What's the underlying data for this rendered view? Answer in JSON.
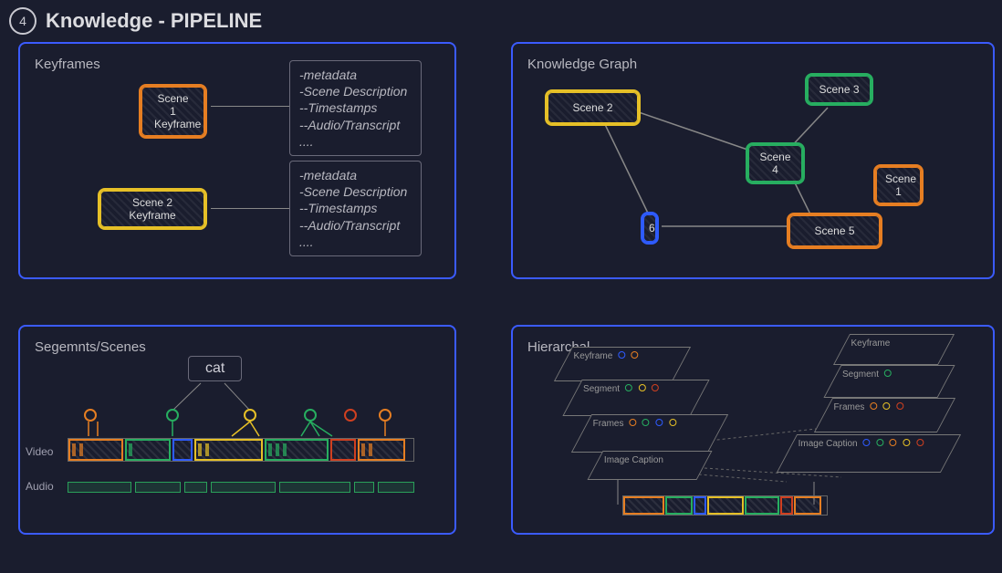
{
  "header": {
    "step_num": "4",
    "title": "Knowledge - PIPELINE"
  },
  "panels": {
    "keyframes": {
      "title": "Keyframes",
      "scene1": {
        "line1": "Scene 1",
        "line2": "Keyframe"
      },
      "scene2": {
        "line1": "Scene 2",
        "line2": "Keyframe"
      },
      "meta1": "-metadata\n-Scene Description\n--Timestamps\n--Audio/Transcript\n....",
      "meta2": "-metadata\n-Scene Description\n --Timestamps\n--Audio/Transcript\n...."
    },
    "graph": {
      "title": "Knowledge Graph",
      "nodes": {
        "s1": "Scene 1",
        "s2": "Scene 2",
        "s3": "Scene 3",
        "s4": "Scene 4",
        "s5": "Scene 5",
        "s6": "6"
      }
    },
    "segments": {
      "title": "Segemnts/Scenes",
      "cat_label": "cat",
      "row_video": "Video",
      "row_audio": "Audio"
    },
    "hier": {
      "title": "Hierarchal",
      "labels": {
        "keyframe": "Keyframe",
        "segment": "Segment",
        "frames": "Frames",
        "image_caption": "Image Caption"
      }
    }
  }
}
